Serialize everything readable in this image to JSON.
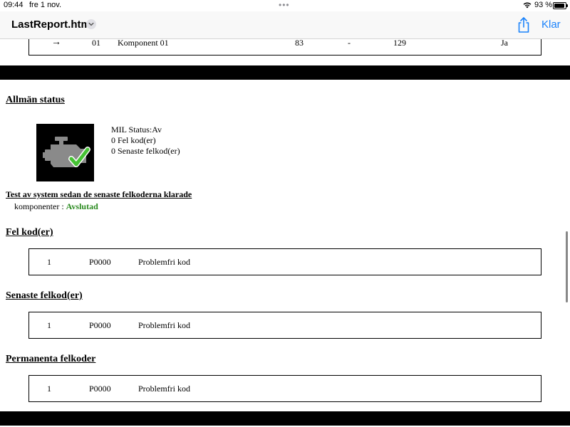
{
  "status_bar": {
    "time": "09:44",
    "date": "fre 1 nov.",
    "battery": "93 %"
  },
  "nav": {
    "title": "LastReport.html",
    "done": "Klar"
  },
  "components_row": {
    "arrow": "→",
    "index": "01",
    "name": "Komponent 01",
    "value1": "83",
    "value2": "-",
    "value3": "129",
    "status": "Ja"
  },
  "general_status": {
    "heading": "Allmän status",
    "mil_status": "MIL Status:Av",
    "fault_codes": "0 Fel kod(er)",
    "recent_codes": "0 Senaste felkod(er)",
    "test_title": "Test av system sedan de senaste felkoderna klarade",
    "components_label": "komponenter : ",
    "components_value": "Avslutad"
  },
  "sections": [
    {
      "heading": "Fel kod(er)",
      "row": {
        "num": "1",
        "code": "P0000",
        "desc": "Problemfri kod"
      }
    },
    {
      "heading": "Senaste felkod(er)",
      "row": {
        "num": "1",
        "code": "P0000",
        "desc": "Problemfri kod"
      }
    },
    {
      "heading": "Permanenta felkoder",
      "row": {
        "num": "1",
        "code": "P0000",
        "desc": "Problemfri kod"
      }
    }
  ],
  "colors": {
    "accent": "#1a82fb",
    "success": "#2a8a1f"
  }
}
